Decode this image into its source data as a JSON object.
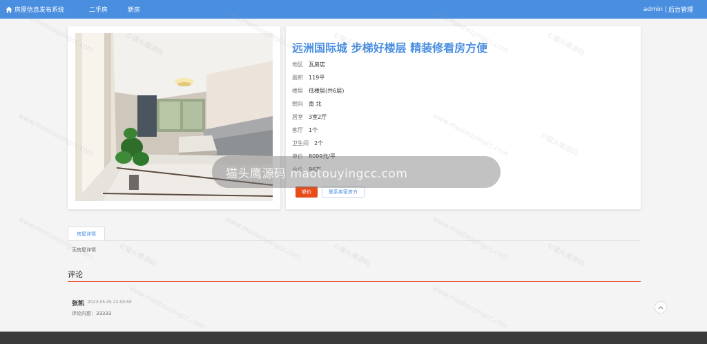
{
  "navbar": {
    "brand": "房屋信息发布系统",
    "links": [
      "二手房",
      "新房"
    ],
    "user": "admin",
    "separator": "|",
    "admin_link": "后台管理",
    "bg_color": "#4a8ee0"
  },
  "house": {
    "title": "远洲国际城 步梯好楼层 精装修看房方便",
    "attributes": [
      {
        "key": "地区",
        "value": "瓦房店"
      },
      {
        "key": "面积",
        "value": "119平"
      },
      {
        "key": "楼层",
        "value": "低楼层(共6层)"
      },
      {
        "key": "朝向",
        "value": "南 北"
      },
      {
        "key": "居室",
        "value": "3室2厅"
      },
      {
        "key": "客厅",
        "value": "1个"
      },
      {
        "key": "卫生间",
        "value": "2个"
      },
      {
        "key": "单价",
        "value": "8099元/平"
      },
      {
        "key": "总价",
        "value": "96万"
      }
    ],
    "buy_label": "够价",
    "contact_label": "联系卖家房方"
  },
  "watermark": {
    "pill_text": "猫头鹰源码 maotouyingcc.com",
    "diagonal_a": "©猫头鹰源码",
    "diagonal_b": "www.maotouyingcc.com"
  },
  "details": {
    "tab_label": "房屋详情",
    "content": "无房屋详情"
  },
  "comments": {
    "title": "评论",
    "items": [
      {
        "name": "张凯",
        "time": "2023-05-05 22:00:50",
        "body": "评论内容：33333"
      }
    ]
  },
  "colors": {
    "accent": "#4a8ee0",
    "buy": "#e74c1a",
    "rule": "#e85a3a"
  }
}
